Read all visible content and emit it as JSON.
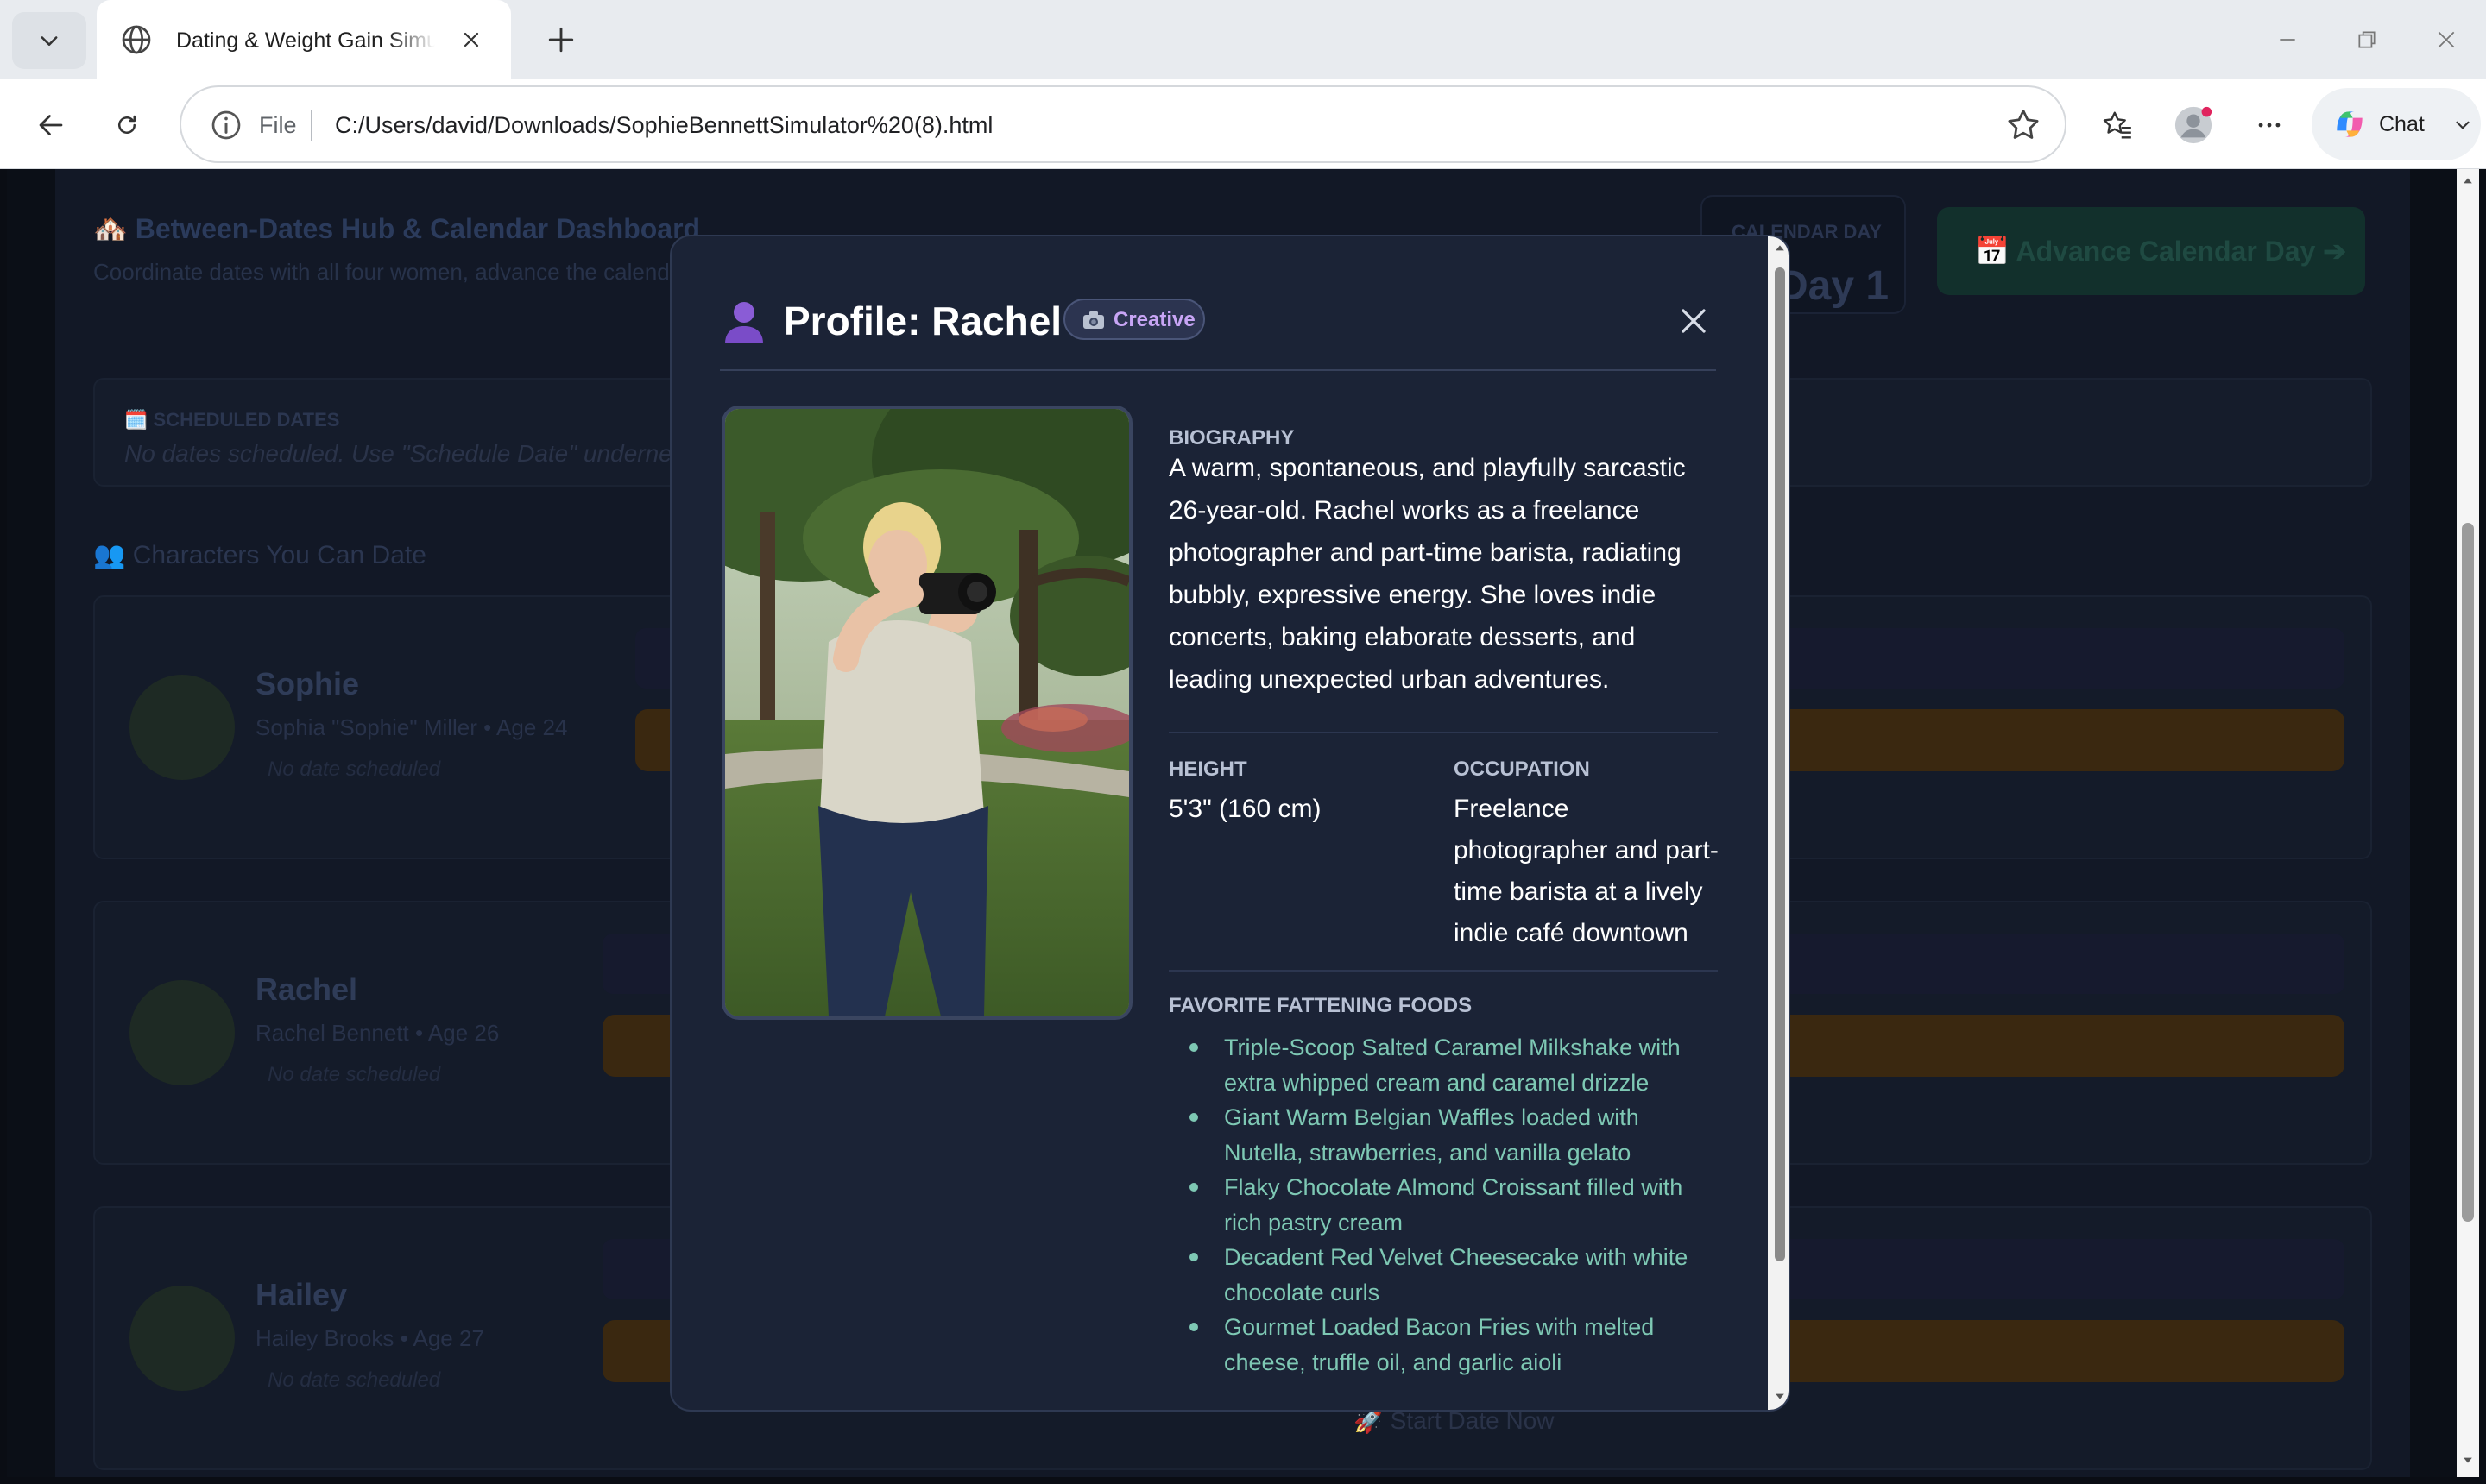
{
  "browser": {
    "tab_title": "Dating & Weight Gain Simulator",
    "url_scheme_label": "File",
    "url": "C:/Users/david/Downloads/SophieBennettSimulator%20(8).html",
    "chat_label": "Chat"
  },
  "page": {
    "hub_title": "🏘️ Between-Dates Hub & Calendar Dashboard",
    "hub_subtitle": "Coordinate dates with all four women, advance the calendar",
    "calendar_label": "CALENDAR DAY",
    "calendar_value": "Day 1",
    "advance_button": "📅 Advance Calendar Day ➔",
    "scheduled_title": "🗓️ SCHEDULED DATES",
    "scheduled_empty": "No dates scheduled. Use \"Schedule Date\" underneath",
    "characters_title": "👥 Characters You Can Date",
    "characters": [
      {
        "name": "Sophie",
        "detail": "Sophia \"Sophie\" Miller • Age 24",
        "status": "No date scheduled"
      },
      {
        "name": "Rachel",
        "detail": "Rachel Bennett • Age 26",
        "status": "No date scheduled"
      },
      {
        "name": "Hailey",
        "detail": "Hailey Brooks • Age 27",
        "status": "No date scheduled"
      }
    ],
    "start_date_now": "🚀 Start Date Now"
  },
  "modal": {
    "icon": "person-silhouette-icon",
    "title": "Profile: Rachel",
    "badge": "Creative",
    "badge_icon": "camera-icon",
    "biography_label": "BIOGRAPHY",
    "biography": "A warm, spontaneous, and playfully sarcastic 26-year-old. Rachel works as a freelance photographer and part-time barista, radiating bubbly, expressive energy. She loves indie concerts, baking elaborate desserts, and leading unexpected urban adventures.",
    "height_label": "HEIGHT",
    "height": "5'3\" (160 cm)",
    "occupation_label": "OCCUPATION",
    "occupation": "Freelance photographer and part-time barista at a lively indie café downtown",
    "foods_label": "FAVORITE FATTENING FOODS",
    "foods": [
      "Triple-Scoop Salted Caramel Milkshake with extra whipped cream and caramel drizzle",
      "Giant Warm Belgian Waffles loaded with Nutella, strawberries, and vanilla gelato",
      "Flaky Chocolate Almond Croissant filled with rich pastry cream",
      "Decadent Red Velvet Cheesecake with white chocolate curls",
      "Gourmet Loaded Bacon Fries with melted cheese, truffle oil, and garlic aioli"
    ]
  },
  "colors": {
    "modal_bg": "#1b2336",
    "accent_green": "#7ec8b4",
    "badge_text": "#c8a5f5"
  }
}
